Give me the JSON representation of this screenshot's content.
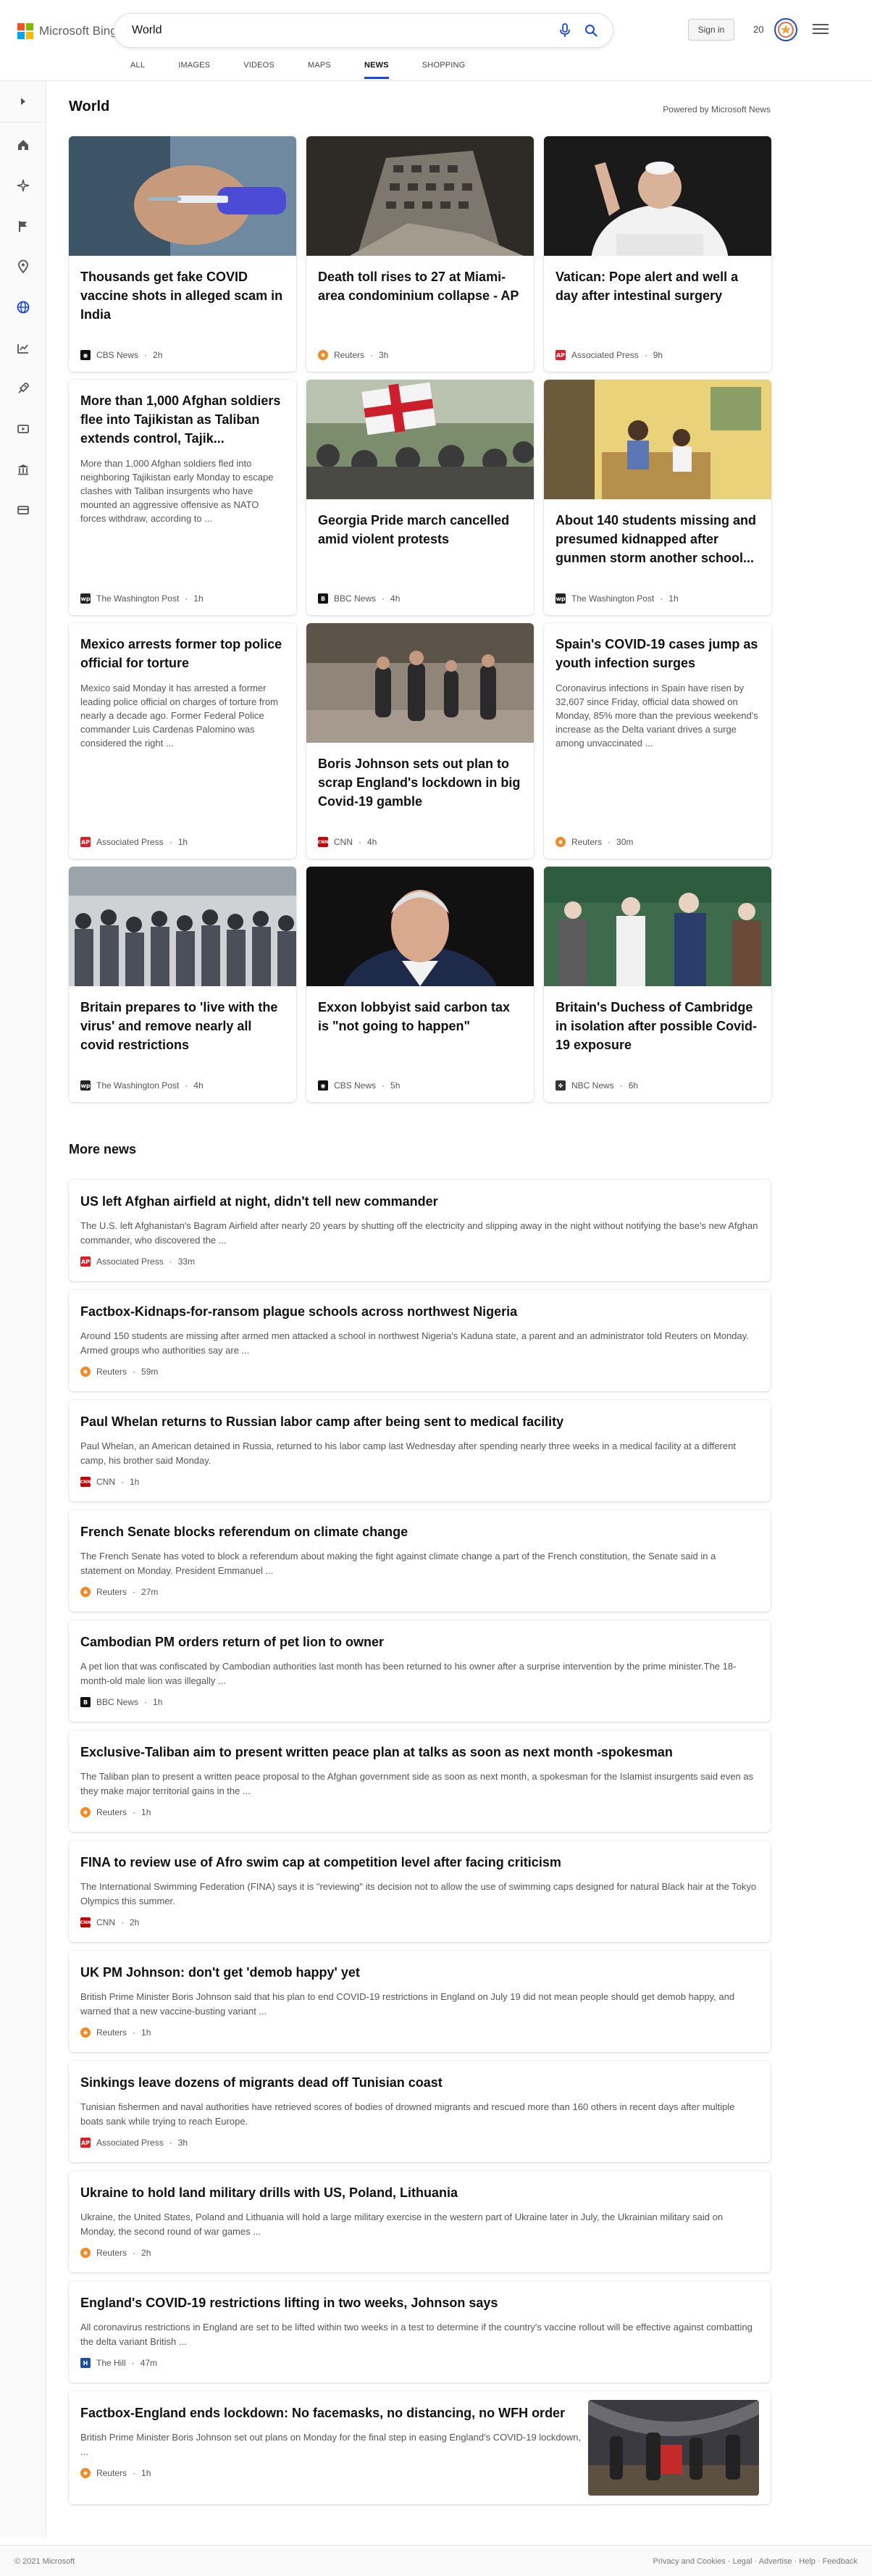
{
  "header": {
    "logo_text": "Microsoft Bing",
    "search_value": "World",
    "signin_label": "Sign in",
    "rewards_count": "20",
    "logo_colors": [
      "#f25022",
      "#7fba00",
      "#00a4ef",
      "#ffb900"
    ]
  },
  "tabs": [
    {
      "label": "ALL",
      "active": false
    },
    {
      "label": "IMAGES",
      "active": false
    },
    {
      "label": "VIDEOS",
      "active": false
    },
    {
      "label": "MAPS",
      "active": false
    },
    {
      "label": "NEWS",
      "active": true
    },
    {
      "label": "SHOPPING",
      "active": false
    }
  ],
  "rail_icons": [
    "expand-icon",
    "home-icon",
    "recommended-icon",
    "flag-icon",
    "location-icon",
    "world-icon",
    "business-icon",
    "science-technology-icon",
    "entertainment-icon",
    "politics-icon",
    "finance-icon"
  ],
  "section": {
    "title": "World",
    "powered_by": "Powered by Microsoft News"
  },
  "cards": [
    {
      "title": "Thousands get fake COVID vaccine shots in alleged scam in India",
      "snippet": "",
      "source": "CBS News",
      "time": "2h",
      "logo": "cbs",
      "has_image": true,
      "image": "vaccine"
    },
    {
      "title": "Death toll rises to 27 at Miami-area condominium collapse - AP",
      "snippet": "",
      "source": "Reuters",
      "time": "3h",
      "logo": "reuters",
      "has_image": true,
      "image": "building"
    },
    {
      "title": "Vatican: Pope alert and well a day after intestinal surgery",
      "snippet": "",
      "source": "Associated Press",
      "time": "9h",
      "logo": "ap",
      "has_image": true,
      "image": "pope"
    },
    {
      "title": "More than 1,000 Afghan soldiers flee into Tajikistan as Taliban extends control, Tajik...",
      "snippet": "More than 1,000 Afghan soldiers fled into neighboring Tajikistan early Monday to escape clashes with Taliban insurgents who have mounted an aggressive offensive as NATO forces withdraw, according to ...",
      "source": "The Washington Post",
      "time": "1h",
      "logo": "wp",
      "has_image": false
    },
    {
      "title": "Georgia Pride march cancelled amid violent protests",
      "snippet": "",
      "source": "BBC News",
      "time": "4h",
      "logo": "bbc",
      "has_image": true,
      "image": "protest"
    },
    {
      "title": "About 140 students missing and presumed kidnapped after gunmen storm another school...",
      "snippet": "",
      "source": "The Washington Post",
      "time": "1h",
      "logo": "wp",
      "has_image": true,
      "image": "classroom"
    },
    {
      "title": "Mexico arrests former top police official for torture",
      "snippet": "Mexico said Monday it has arrested a former leading police official on charges of torture from nearly a decade ago. Former Federal Police commander Luis Cardenas Palomino was considered the right ...",
      "source": "Associated Press",
      "time": "1h",
      "logo": "ap",
      "has_image": false
    },
    {
      "title": "Boris Johnson sets out plan to scrap England's lockdown in big Covid-19 gamble",
      "snippet": "",
      "source": "CNN",
      "time": "4h",
      "logo": "cnn",
      "has_image": true,
      "image": "street"
    },
    {
      "title": "Spain's COVID-19 cases jump as youth infection surges",
      "snippet": "Coronavirus infections in Spain have risen by 32,607 since Friday, official data showed on Monday, 85% more than the previous weekend's increase as the Delta variant drives a surge among unvaccinated ...",
      "source": "Reuters",
      "time": "30m",
      "logo": "reuters",
      "has_image": false
    },
    {
      "title": "Britain prepares to 'live with the virus' and remove nearly all covid restrictions",
      "snippet": "",
      "source": "The Washington Post",
      "time": "4h",
      "logo": "wp",
      "has_image": true,
      "image": "crowd"
    },
    {
      "title": "Exxon lobbyist said carbon tax is \"not going to happen\"",
      "snippet": "",
      "source": "CBS News",
      "time": "5h",
      "logo": "cbs",
      "has_image": true,
      "image": "portrait"
    },
    {
      "title": "Britain's Duchess of Cambridge in isolation after possible Covid-19 exposure",
      "snippet": "",
      "source": "NBC News",
      "time": "6h",
      "logo": "nbc",
      "has_image": true,
      "image": "stands"
    }
  ],
  "more_news_title": "More news",
  "news": [
    {
      "title": "US left Afghan airfield at night, didn't tell new commander",
      "snippet": "The U.S. left Afghanistan's Bagram Airfield after nearly 20 years by shutting off the electricity and slipping away in the night without notifying the base's new Afghan commander, who discovered the ...",
      "source": "Associated Press",
      "time": "33m",
      "logo": "ap"
    },
    {
      "title": "Factbox-Kidnaps-for-ransom plague schools across northwest Nigeria",
      "snippet": "Around 150 students are missing after armed men attacked a school in northwest Nigeria's Kaduna state, a parent and an administrator told Reuters on Monday. Armed groups who authorities say are ...",
      "source": "Reuters",
      "time": "59m",
      "logo": "reuters"
    },
    {
      "title": "Paul Whelan returns to Russian labor camp after being sent to medical facility",
      "snippet": "Paul Whelan, an American detained in Russia, returned to his labor camp last Wednesday after spending nearly three weeks in a medical facility at a different camp, his brother said Monday.",
      "source": "CNN",
      "time": "1h",
      "logo": "cnn"
    },
    {
      "title": "French Senate blocks referendum on climate change",
      "snippet": "The French Senate has voted to block a referendum about making the fight against climate change a part of the French constitution, the Senate said in a statement on Monday. President Emmanuel ...",
      "source": "Reuters",
      "time": "27m",
      "logo": "reuters"
    },
    {
      "title": "Cambodian PM orders return of pet lion to owner",
      "snippet": "A pet lion that was confiscated by Cambodian authorities last month has been returned to his owner after a surprise intervention by the prime minister.The 18-month-old male lion was illegally ...",
      "source": "BBC News",
      "time": "1h",
      "logo": "bbc"
    },
    {
      "title": "Exclusive-Taliban aim to present written peace plan at talks as soon as next month -spokesman",
      "snippet": "The Taliban plan to present a written peace proposal to the Afghan government side as soon as next month, a spokesman for the Islamist insurgents said even as they make major territorial gains in the ...",
      "source": "Reuters",
      "time": "1h",
      "logo": "reuters"
    },
    {
      "title": "FINA to review use of Afro swim cap at competition level after facing criticism",
      "snippet": "The International Swimming Federation (FINA) says it is \"reviewing\" its decision not to allow the use of swimming caps designed for natural Black hair at the Tokyo Olympics this summer.",
      "source": "CNN",
      "time": "2h",
      "logo": "cnn"
    },
    {
      "title": "UK PM Johnson: don't get 'demob happy' yet",
      "snippet": "British Prime Minister Boris Johnson said that his plan to end COVID-19 restrictions in England on July 19 did not mean people should get demob happy, and warned that a new vaccine-busting variant ...",
      "source": "Reuters",
      "time": "1h",
      "logo": "reuters"
    },
    {
      "title": "Sinkings leave dozens of migrants dead off Tunisian coast",
      "snippet": "Tunisian fishermen and naval authorities have retrieved scores of bodies of drowned migrants and rescued more than 160 others in recent days after multiple boats sank while trying to reach Europe.",
      "source": "Associated Press",
      "time": "3h",
      "logo": "ap"
    },
    {
      "title": "Ukraine to hold land military drills with US, Poland, Lithuania",
      "snippet": "Ukraine, the United States, Poland and Lithuania will hold a large military exercise in the western part of Ukraine later in July, the Ukrainian military said on Monday, the second round of war games ...",
      "source": "Reuters",
      "time": "2h",
      "logo": "reuters"
    },
    {
      "title": "England's COVID-19 restrictions lifting in two weeks, Johnson says",
      "snippet": "All coronavirus restrictions in England are set to be lifted within two weeks in a test to determine if the country's vaccine rollout will be effective against combatting the delta variant British ...",
      "source": "The Hill",
      "time": "47m",
      "logo": "hill"
    },
    {
      "title": "Factbox-England ends lockdown: No facemasks, no distancing, no WFH order",
      "snippet": "British Prime Minister Boris Johnson set out plans on Monday for the final step in easing England's COVID-19 lockdown, ...",
      "source": "Reuters",
      "time": "1h",
      "logo": "reuters",
      "thumb": true
    }
  ],
  "footer": {
    "left": "© 2021 Microsoft",
    "right": "Privacy and Cookies · Legal · Advertise · Help · Feedback"
  },
  "colors": {
    "accent": "#174ae4",
    "cbs": "#111111",
    "reuters": "#f08a24",
    "ap": "#e31b23",
    "wp": "#222222",
    "bbc": "#111111",
    "cnn": "#cc0000",
    "nbc": "#333333",
    "hill": "#1f4fa3"
  }
}
